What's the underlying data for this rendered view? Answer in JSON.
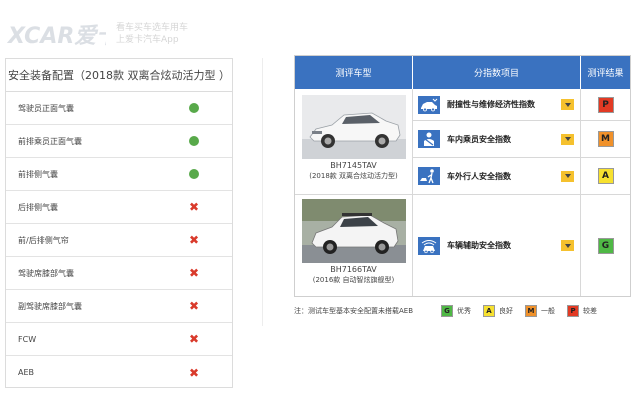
{
  "watermark": {
    "logo_text": "XCAR爱卡",
    "line1": "看车买车选车用车",
    "line2": "上爱卡汽车App"
  },
  "safety_table": {
    "title": "安全装备配置（2018款 双离合炫动活力型 ）",
    "items": [
      {
        "label": "驾驶员正面气囊",
        "available": true
      },
      {
        "label": "前排乘员正面气囊",
        "available": true
      },
      {
        "label": "前排侧气囊",
        "available": true
      },
      {
        "label": "后排侧气囊",
        "available": false
      },
      {
        "label": "前/后排侧气帘",
        "available": false
      },
      {
        "label": "驾驶席膝部气囊",
        "available": false
      },
      {
        "label": "副驾驶席膝部气囊",
        "available": false
      },
      {
        "label": "FCW",
        "available": false
      },
      {
        "label": "AEB",
        "available": false
      }
    ]
  },
  "eval_table": {
    "headers": {
      "car": "测评车型",
      "items": "分指数项目",
      "result": "测评结果"
    },
    "cars": [
      {
        "model": "BH7145TAV",
        "desc": "(2018款 双离合炫动活力型)"
      },
      {
        "model": "BH7166TAV",
        "desc": "(2016款 自动智炫旗舰型)"
      }
    ],
    "scores": [
      {
        "icon": "car-durability-icon",
        "label": "耐撞性与维修经济性指数",
        "grade": "P",
        "grade_color": "#e23a24"
      },
      {
        "icon": "occupant-safety-icon",
        "label": "车内乘员安全指数",
        "grade": "M",
        "grade_color": "#f0912a"
      },
      {
        "icon": "pedestrian-safety-icon",
        "label": "车外行人安全指数",
        "grade": "A",
        "grade_color": "#f7e12f"
      },
      {
        "icon": "driver-assist-icon",
        "label": "车辆辅助安全指数",
        "grade": "G",
        "grade_color": "#4fb845"
      }
    ]
  },
  "legend": {
    "note": "注：测试车型基本安全配置未搭载AEB",
    "items": [
      {
        "letter": "G",
        "label": "优秀",
        "color": "#4fb845"
      },
      {
        "letter": "A",
        "label": "良好",
        "color": "#f7e12f"
      },
      {
        "letter": "M",
        "label": "一般",
        "color": "#f0912a"
      },
      {
        "letter": "P",
        "label": "较差",
        "color": "#e23a24"
      }
    ]
  },
  "colors": {
    "header_blue": "#3a72c0",
    "check_green": "#58a94a",
    "cross_red": "#d93a2b",
    "dropdown_yellow": "#f5c12e"
  }
}
